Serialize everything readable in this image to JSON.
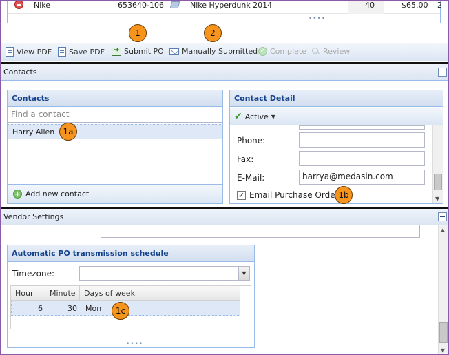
{
  "top_grid": {
    "row": {
      "brand": "Nike",
      "sku": "653640-106",
      "product": "Nike Hyperdunk 2014",
      "qty": "40",
      "price": "$65.00",
      "extra": "2"
    }
  },
  "toolbar": {
    "view_pdf": "View PDF",
    "save_pdf": "Save PDF",
    "submit_po": "Submit PO",
    "manually_submitted": "Manually Submitted",
    "complete": "Complete",
    "review": "Review"
  },
  "callouts": {
    "c1": "1",
    "c2": "2",
    "c1a": "1a",
    "c1b": "1b",
    "c1c": "1c"
  },
  "contacts_section": {
    "title": "Contacts",
    "list_panel": {
      "title": "Contacts",
      "search_placeholder": "Find a contact",
      "items": [
        "Harry Allen"
      ],
      "add_label": "Add new contact"
    },
    "detail_panel": {
      "title": "Contact Detail",
      "status": "Active",
      "phone_label": "Phone:",
      "phone_value": "",
      "fax_label": "Fax:",
      "fax_value": "",
      "email_label": "E-Mail:",
      "email_value": "harrya@medasin.com",
      "email_po_label": "Email Purchase Orders",
      "email_po_checked": true
    }
  },
  "vendor_section": {
    "title": "Vendor Settings",
    "schedule_panel": {
      "title": "Automatic PO transmission schedule",
      "timezone_label": "Timezone:",
      "timezone_value": "",
      "columns": [
        "Hour",
        "Minute",
        "Days of week"
      ],
      "rows": [
        {
          "hour": "6",
          "minute": "30",
          "days": "Mon"
        }
      ]
    }
  },
  "colors": {
    "accent": "#15428b",
    "border": "#99bbe8",
    "callout": "#f7941d",
    "separator": "#111111"
  }
}
